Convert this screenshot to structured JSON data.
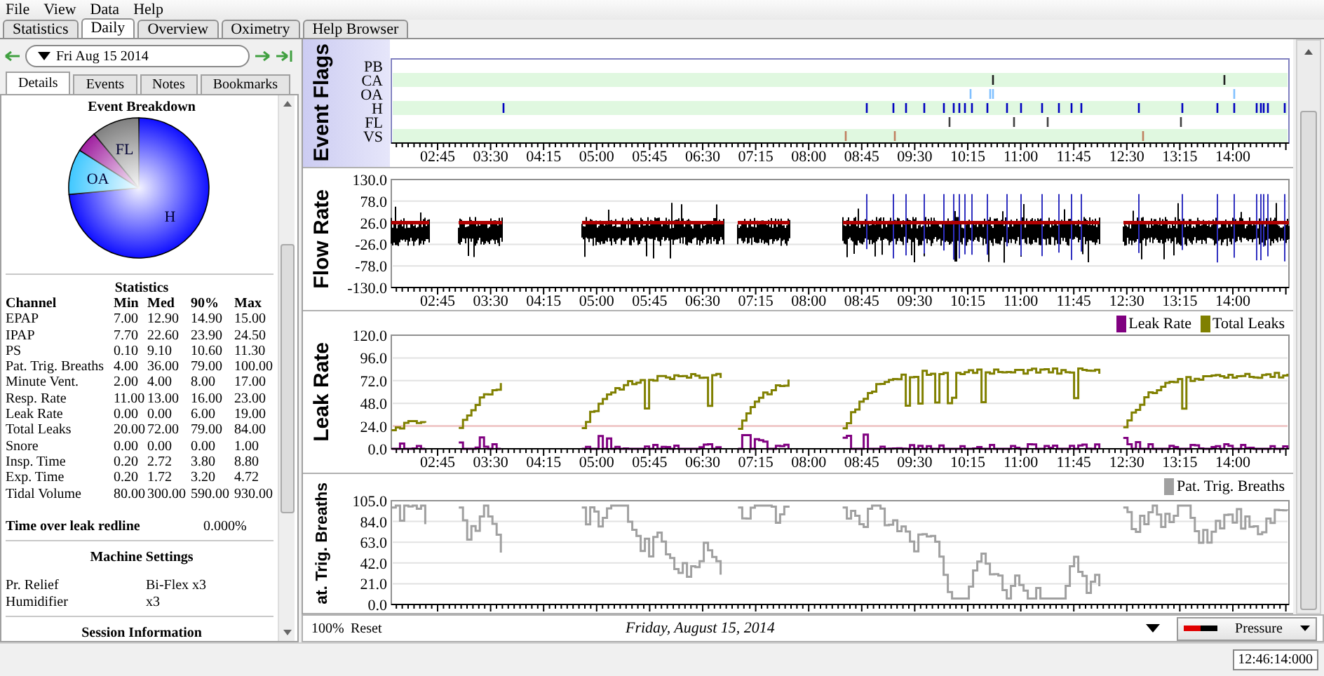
{
  "menu": [
    "File",
    "View",
    "Data",
    "Help"
  ],
  "tabs": [
    {
      "label": "Statistics",
      "selected": false
    },
    {
      "label": "Daily",
      "selected": true
    },
    {
      "label": "Overview",
      "selected": false
    },
    {
      "label": "Oximetry",
      "selected": false
    },
    {
      "label": "Help Browser",
      "selected": false
    }
  ],
  "date_nav": {
    "date": "Fri Aug 15 2014"
  },
  "detail_tabs": [
    {
      "label": "Details",
      "selected": true
    },
    {
      "label": "Events",
      "selected": false
    },
    {
      "label": "Notes",
      "selected": false
    },
    {
      "label": "Bookmarks",
      "selected": false
    }
  ],
  "event_breakdown": {
    "title": "Event Breakdown",
    "slices": [
      {
        "label": "H",
        "color": "#1010ff"
      },
      {
        "label": "OA",
        "color": "#40c8ff"
      },
      {
        "color": "#a020a0"
      },
      {
        "label": "FL",
        "color": "#808080"
      }
    ]
  },
  "statistics": {
    "title": "Statistics",
    "columns": [
      "Channel",
      "Min",
      "Med",
      "90%",
      "Max"
    ],
    "rows": [
      [
        "EPAP",
        "7.00",
        "12.90",
        "14.90",
        "15.00"
      ],
      [
        "IPAP",
        "7.70",
        "22.60",
        "23.90",
        "24.50"
      ],
      [
        "PS",
        "0.10",
        "9.10",
        "10.60",
        "11.30"
      ],
      [
        "Pat. Trig. Breaths",
        "4.00",
        "36.00",
        "79.00",
        "100.00"
      ],
      [
        "Minute Vent.",
        "2.00",
        "4.00",
        "8.00",
        "17.00"
      ],
      [
        "Resp. Rate",
        "11.00",
        "13.00",
        "16.00",
        "23.00"
      ],
      [
        "Leak Rate",
        "0.00",
        "0.00",
        "6.00",
        "19.00"
      ],
      [
        "Total Leaks",
        "20.00",
        "72.00",
        "79.00",
        "84.00"
      ],
      [
        "Snore",
        "0.00",
        "0.00",
        "0.00",
        "1.00"
      ],
      [
        "Insp. Time",
        "0.20",
        "2.72",
        "3.80",
        "8.80"
      ],
      [
        "Exp. Time",
        "0.20",
        "1.72",
        "3.20",
        "4.72"
      ],
      [
        "Tidal Volume",
        "80.00",
        "300.00",
        "590.00",
        "930.00"
      ]
    ]
  },
  "leak_redline": {
    "label": "Time over leak redline",
    "value": "0.000%"
  },
  "machine_settings": {
    "title": "Machine Settings",
    "rows": [
      [
        "Pr. Relief",
        "Bi-Flex x3"
      ],
      [
        "Humidifier",
        "x3"
      ]
    ]
  },
  "session_information": {
    "title": "Session Information"
  },
  "graphs": [
    {
      "kind": "flags",
      "title": "Event Flags",
      "rows": [
        {
          "label": "PB"
        },
        {
          "label": "CA",
          "color": "#202020"
        },
        {
          "label": "OA",
          "color": "#80c0ff"
        },
        {
          "label": "H",
          "color": "#0000c0"
        },
        {
          "label": "FL",
          "color": "#404040"
        },
        {
          "label": "VS",
          "color": "#c08060"
        }
      ],
      "xticks": [
        "02:45",
        "03:30",
        "04:15",
        "05:00",
        "05:45",
        "06:30",
        "07:15",
        "08:00",
        "08:45",
        "09:30",
        "10:15",
        "11:00",
        "11:45",
        "12:30",
        "13:15",
        "14:00"
      ]
    },
    {
      "kind": "flow",
      "title": "Flow Rate",
      "yticks": [
        "130.0",
        "78.0",
        "26.0",
        "-26.0",
        "-78.0",
        "-130.0"
      ],
      "xticks": [
        "02:45",
        "03:30",
        "04:15",
        "05:00",
        "05:45",
        "06:30",
        "07:15",
        "08:00",
        "08:45",
        "09:30",
        "10:15",
        "11:00",
        "11:45",
        "12:30",
        "13:15",
        "14:00"
      ]
    },
    {
      "kind": "leak",
      "title": "Leak Rate",
      "legend": [
        {
          "label": "Leak Rate",
          "color": "#800080"
        },
        {
          "label": "Total Leaks",
          "color": "#808000"
        }
      ],
      "yticks": [
        "120.0",
        "96.0",
        "72.0",
        "48.0",
        "24.0",
        "0.0"
      ],
      "xticks": [
        "02:45",
        "03:30",
        "04:15",
        "05:00",
        "05:45",
        "06:30",
        "07:15",
        "08:00",
        "08:45",
        "09:30",
        "10:15",
        "11:00",
        "11:45",
        "12:30",
        "13:15",
        "14:00"
      ]
    },
    {
      "kind": "breaths",
      "title": "at. Trig. Breaths",
      "legend": [
        {
          "label": "Pat. Trig. Breaths",
          "color": "#a0a0a0"
        }
      ],
      "yticks": [
        "105.0",
        "84.0",
        "63.0",
        "42.0",
        "21.0",
        "0.0"
      ]
    }
  ],
  "graph_toolbar": {
    "zoom": "100%",
    "reset": "Reset",
    "date": "Friday, August 15, 2014",
    "channel": "Pressure"
  },
  "status_bar": {
    "time": "12:46:14:000"
  }
}
